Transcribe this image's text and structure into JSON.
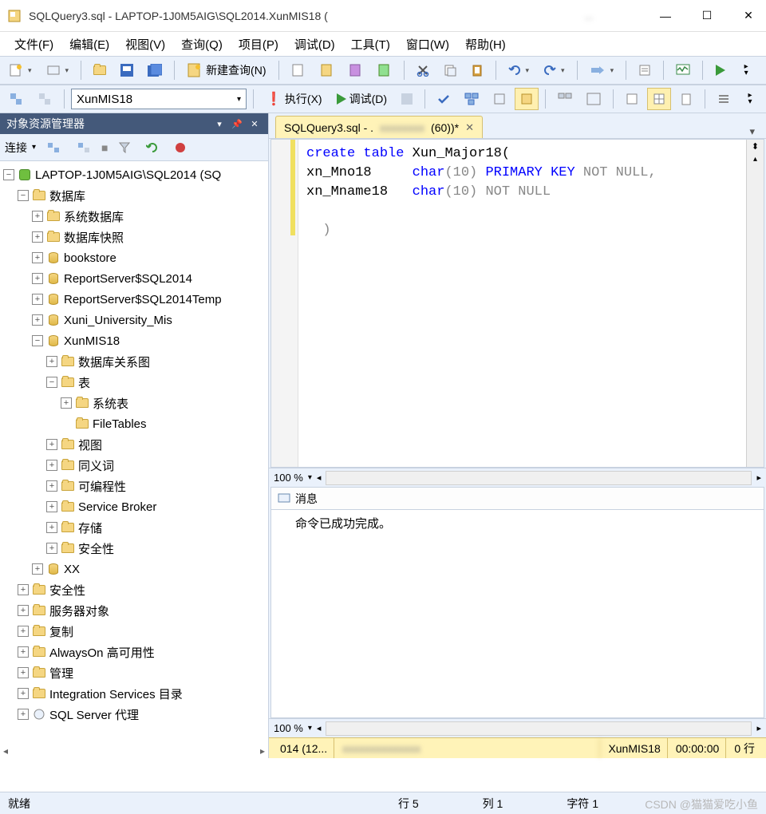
{
  "titlebar": {
    "title": "SQLQuery3.sql - LAPTOP-1J0M5AIG\\SQL2014.XunMIS18 ("
  },
  "menu": {
    "file": "文件(F)",
    "edit": "编辑(E)",
    "view": "视图(V)",
    "query": "查询(Q)",
    "project": "项目(P)",
    "debug": "调试(D)",
    "tools": "工具(T)",
    "window": "窗口(W)",
    "help": "帮助(H)"
  },
  "toolbar": {
    "newquery": "新建查询(N)"
  },
  "toolbar2": {
    "db_selected": "XunMIS18",
    "execute": "执行(X)",
    "debug": "调试(D)"
  },
  "sidebar": {
    "title": "对象资源管理器",
    "connect": "连接",
    "server": "LAPTOP-1J0M5AIG\\SQL2014 (SQ",
    "nodes": {
      "databases": "数据库",
      "sysdb": "系统数据库",
      "dbsnap": "数据库快照",
      "bookstore": "bookstore",
      "rs": "ReportServer$SQL2014",
      "rstemp": "ReportServer$SQL2014Temp",
      "xuni": "Xuni_University_Mis",
      "xunmis": "XunMIS18",
      "dbdiagram": "数据库关系图",
      "tables": "表",
      "systables": "系统表",
      "filetables": "FileTables",
      "views": "视图",
      "synonyms": "同义词",
      "programmability": "可编程性",
      "servicebroker": "Service Broker",
      "storage": "存储",
      "security": "安全性",
      "xx": "XX",
      "security2": "安全性",
      "serverobj": "服务器对象",
      "replication": "复制",
      "alwayson": "AlwaysOn 高可用性",
      "management": "管理",
      "iscatalog": "Integration Services 目录",
      "sqlagent": "SQL Server 代理"
    }
  },
  "editor": {
    "tab_label": "SQLQuery3.sql - .",
    "tab_suffix": "(60))*",
    "zoom": "100 %",
    "code": {
      "l1a": "create",
      "l1b": "table",
      "l1c": " Xun_Major18(",
      "l2a": "xn_Mno18     ",
      "l2b": "char",
      "l2c": "(10)",
      "l2d": " PRIMARY KEY",
      "l2e": " NOT NULL,",
      "l3a": "xn_Mname18   ",
      "l3b": "char",
      "l3c": "(10)",
      "l3d": " NOT NULL",
      "l5": "  )"
    }
  },
  "messages": {
    "tab": "消息",
    "body": "命令已成功完成。"
  },
  "status": {
    "c1": "014 (12...",
    "c3": "XunMIS18",
    "c4": "00:00:00",
    "c5": "0 行"
  },
  "bottom": {
    "ready": "就绪",
    "row": "行 5",
    "col": "列 1",
    "ch": "字符 1"
  },
  "watermark": "CSDN @猫猫爱吃小鱼"
}
